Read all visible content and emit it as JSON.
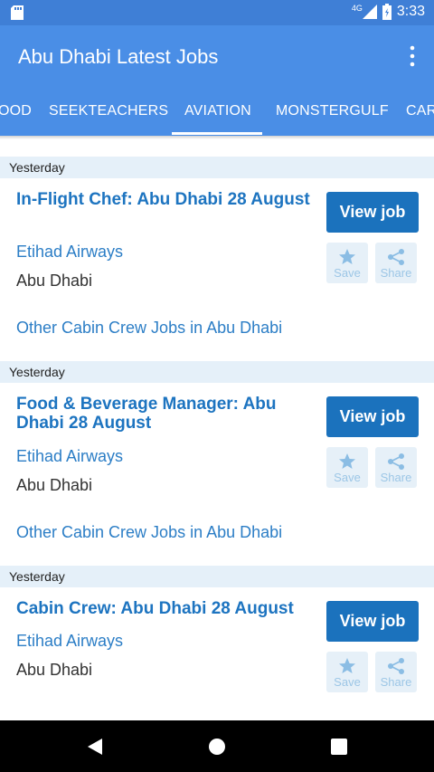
{
  "status_bar": {
    "time": "3:33",
    "network": "4G"
  },
  "app_bar": {
    "title": "Abu Dhabi Latest Jobs"
  },
  "tabs": [
    "OOD",
    "SEEKTEACHERS",
    "AVIATION",
    "MONSTERGULF",
    "CAR"
  ],
  "active_tab": "AVIATION",
  "jobs": [
    {
      "date": "Yesterday",
      "title": "In-Flight Chef: Abu Dhabi 28 August",
      "company": "Etihad Airways",
      "location": "Abu Dhabi",
      "other_link": "Other Cabin Crew Jobs in Abu Dhabi",
      "view_label": "View job",
      "save_label": "Save",
      "share_label": "Share"
    },
    {
      "date": "Yesterday",
      "title": "Food & Beverage Manager: Abu Dhabi 28 August",
      "company": "Etihad Airways",
      "location": "Abu Dhabi",
      "other_link": "Other Cabin Crew Jobs in Abu Dhabi",
      "view_label": "View job",
      "save_label": "Save",
      "share_label": "Share"
    },
    {
      "date": "Yesterday",
      "title": "Cabin Crew: Abu Dhabi 28 August",
      "company": "Etihad Airways",
      "location": "Abu Dhabi",
      "view_label": "View job",
      "save_label": "Save",
      "share_label": "Share"
    }
  ],
  "icons": {
    "sd": "sd-card-icon",
    "signal": "signal-icon",
    "battery": "battery-icon",
    "menu": "more-vert-icon",
    "save": "star-icon",
    "share": "share-icon",
    "back": "back-icon",
    "home": "home-icon",
    "recents": "recents-icon"
  },
  "colors": {
    "status_bar": "#3f7fd6",
    "app_bar": "#4a8ee6",
    "accent": "#1b72bd",
    "link": "#2c7ec6",
    "date_bg": "#e5f0f9"
  }
}
